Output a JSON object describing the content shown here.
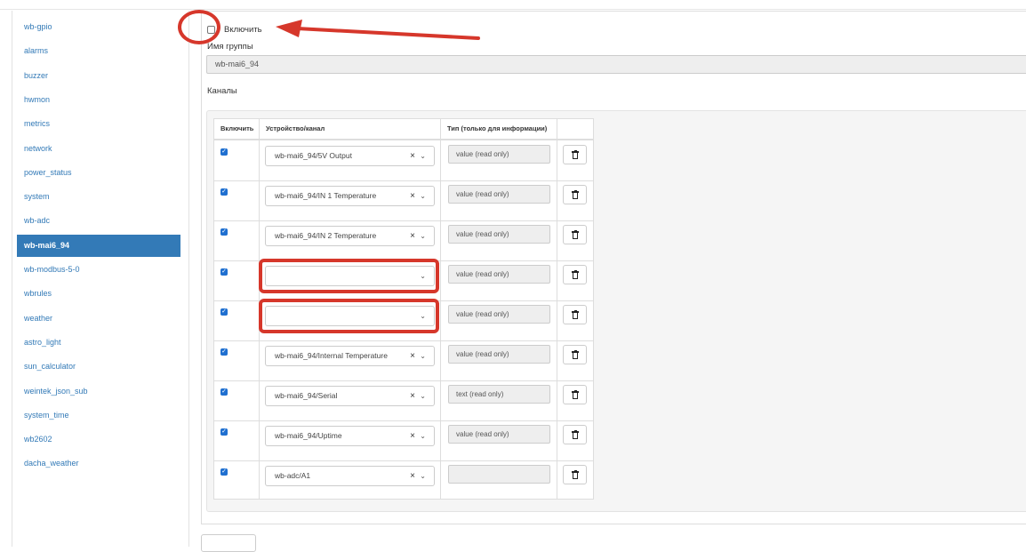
{
  "sidebar": {
    "items": [
      {
        "label": "wb-gpio",
        "active": false
      },
      {
        "label": "alarms",
        "active": false
      },
      {
        "label": "buzzer",
        "active": false
      },
      {
        "label": "hwmon",
        "active": false
      },
      {
        "label": "metrics",
        "active": false
      },
      {
        "label": "network",
        "active": false
      },
      {
        "label": "power_status",
        "active": false
      },
      {
        "label": "system",
        "active": false
      },
      {
        "label": "wb-adc",
        "active": false
      },
      {
        "label": "wb-mai6_94",
        "active": true
      },
      {
        "label": "wb-modbus-5-0",
        "active": false
      },
      {
        "label": "wbrules",
        "active": false
      },
      {
        "label": "weather",
        "active": false
      },
      {
        "label": "astro_light",
        "active": false
      },
      {
        "label": "sun_calculator",
        "active": false
      },
      {
        "label": "weintek_json_sub",
        "active": false
      },
      {
        "label": "system_time",
        "active": false
      },
      {
        "label": "wb2602",
        "active": false
      },
      {
        "label": "dacha_weather",
        "active": false
      }
    ]
  },
  "form": {
    "enable_label": "Включить",
    "enable_checked": false,
    "group_name_label": "Имя группы",
    "group_name_value": "wb-mai6_94",
    "channels_label": "Каналы"
  },
  "table": {
    "headers": [
      "Включить",
      "Устройство/канал",
      "Тип (только для информации)",
      ""
    ],
    "rows": [
      {
        "enabled": true,
        "channel": "wb-mai6_94/5V Output",
        "has_clear": true,
        "type": "value (read only)"
      },
      {
        "enabled": true,
        "channel": "wb-mai6_94/IN 1 Temperature",
        "has_clear": true,
        "type": "value (read only)"
      },
      {
        "enabled": true,
        "channel": "wb-mai6_94/IN 2 Temperature",
        "has_clear": true,
        "type": "value (read only)"
      },
      {
        "enabled": true,
        "channel": "",
        "has_clear": false,
        "type": "value (read only)"
      },
      {
        "enabled": true,
        "channel": "",
        "has_clear": false,
        "type": "value (read only)"
      },
      {
        "enabled": true,
        "channel": "wb-mai6_94/Internal Temperature",
        "has_clear": true,
        "type": "value (read only)"
      },
      {
        "enabled": true,
        "channel": "wb-mai6_94/Serial",
        "has_clear": true,
        "type": "text (read only)"
      },
      {
        "enabled": true,
        "channel": "wb-mai6_94/Uptime",
        "has_clear": true,
        "type": "value (read only)"
      },
      {
        "enabled": true,
        "channel": "wb-adc/A1",
        "has_clear": true,
        "type": ""
      }
    ],
    "clear_glyph": "×",
    "arrow_glyph": "⌄",
    "check_glyph": "✓",
    "delete_icon": "trash-icon"
  },
  "annotations": {
    "highlight_color": "#d6372b",
    "highlighted_rows": [
      3,
      4
    ]
  },
  "colors": {
    "accent": "#337ab7",
    "checkbox": "#1f6fd0"
  }
}
